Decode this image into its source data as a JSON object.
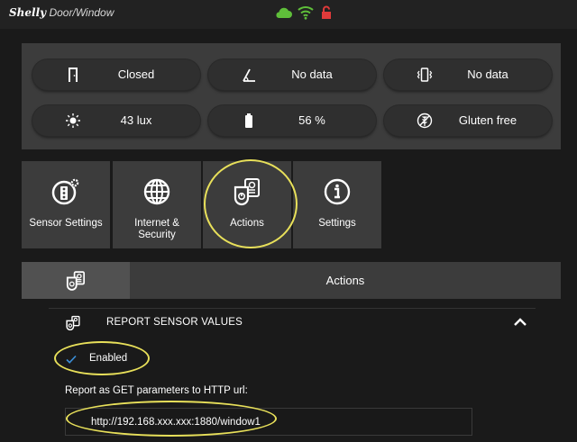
{
  "app": {
    "brand_logo": "Shelly",
    "brand_product": "Door/Window"
  },
  "status_bar": {
    "cloud": {
      "icon": "cloud-icon",
      "color": "#5fbf3a"
    },
    "wifi": {
      "icon": "wifi-icon",
      "color": "#5fbf3a"
    },
    "lock": {
      "icon": "lock-icon",
      "color": "#e03a3a"
    }
  },
  "sensors": [
    {
      "icon": "door-icon",
      "value": "Closed"
    },
    {
      "icon": "tilt-angle-icon",
      "value": "No data"
    },
    {
      "icon": "vibration-icon",
      "value": "No data"
    },
    {
      "icon": "sun-icon",
      "value": "43 lux"
    },
    {
      "icon": "battery-icon",
      "value": "56 %"
    },
    {
      "icon": "gluten-free-icon",
      "value": "Gluten free"
    }
  ],
  "menu": [
    {
      "icon": "sensor-settings-icon",
      "label": "Sensor Settings"
    },
    {
      "icon": "globe-icon",
      "label": "Internet & Security"
    },
    {
      "icon": "actions-icon",
      "label": "Actions"
    },
    {
      "icon": "info-icon",
      "label": "Settings"
    }
  ],
  "actions_page": {
    "title": "Actions",
    "section": {
      "title": "REPORT SENSOR VALUES",
      "enabled_label": "Enabled",
      "url_label": "Report as GET parameters to HTTP url:",
      "url_value": "http://192.168.xxx.xxx:1880/window1"
    }
  },
  "colors": {
    "accent_highlight": "#e8e05a",
    "check": "#3b8fd8"
  }
}
